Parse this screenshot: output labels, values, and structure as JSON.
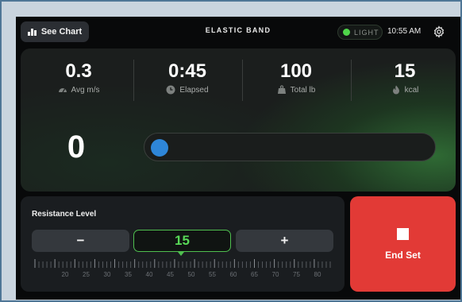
{
  "header": {
    "see_chart_label": "See Chart",
    "title": "ELASTIC BAND",
    "light_label": "LIGHT",
    "time": "10:55 AM"
  },
  "stats": [
    {
      "value": "0.3",
      "label": "Avg m/s",
      "icon": "speedometer-icon"
    },
    {
      "value": "0:45",
      "label": "Elapsed",
      "icon": "clock-icon"
    },
    {
      "value": "100",
      "label": "Total lb",
      "icon": "weight-icon"
    },
    {
      "value": "15",
      "label": "kcal",
      "icon": "flame-icon"
    }
  ],
  "rep_count": "0",
  "progress": 0,
  "resistance": {
    "title": "Resistance Level",
    "minus_label": "−",
    "plus_label": "+",
    "value": "15",
    "scale_labels": [
      "20",
      "25",
      "30",
      "35",
      "40",
      "45",
      "50",
      "55",
      "60",
      "65",
      "70",
      "75",
      "80"
    ]
  },
  "end_set_label": "End Set",
  "colors": {
    "accent_green": "#58d857",
    "end_red": "#e23a36",
    "progress_blue": "#2e86d8"
  }
}
